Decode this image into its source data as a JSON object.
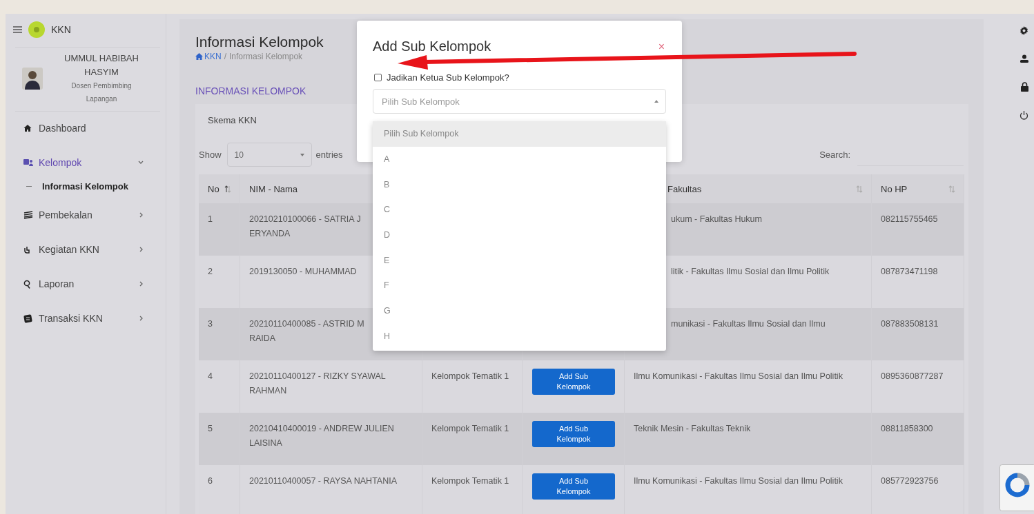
{
  "sidebar": {
    "brand": "KKN",
    "user": {
      "name": "UMMUL HABIBAH HASYIM",
      "role": "Dosen Pembimbing Lapangan"
    },
    "items": [
      {
        "label": "Dashboard",
        "active": false
      },
      {
        "label": "Kelompok",
        "active": true,
        "expanded": true,
        "children": [
          {
            "label": "Informasi Kelompok",
            "selected": true
          }
        ]
      },
      {
        "label": "Pembekalan",
        "active": false,
        "expanded": false
      },
      {
        "label": "Kegiatan KKN",
        "active": false,
        "expanded": false
      },
      {
        "label": "Laporan",
        "active": false,
        "expanded": false
      },
      {
        "label": "Transaksi KKN",
        "active": false,
        "expanded": false
      }
    ]
  },
  "page": {
    "title": "Informasi Kelompok",
    "breadcrumb": [
      "KKN",
      "Informasi Kelompok"
    ],
    "breadcrumb_separator": "/",
    "section_title": "INFORMASI KELOMPOK",
    "filter_label": "Skema KKN"
  },
  "table_controls": {
    "show_label": "Show",
    "page_size": "10",
    "entries_label": "entries",
    "search_label": "Search:"
  },
  "table": {
    "columns": [
      {
        "label": "No",
        "sorted": true
      },
      {
        "label": "NIM - Nama"
      },
      {
        "label": "Fakultas",
        "sorted": false
      },
      {
        "label": "No HP",
        "sorted": false
      }
    ],
    "rows": [
      {
        "no": "1",
        "nim_nama": "20210210100066 - SATRIA J\nERYANDA",
        "fakultas": "ukum - Fakultas Hukum",
        "no_hp": "082115755465"
      },
      {
        "no": "2",
        "nim_nama": "2019130050 - MUHAMMAD",
        "fakultas": "litik - Fakultas Ilmu Sosial dan Ilmu Politik",
        "no_hp": "087873471198"
      },
      {
        "no": "3",
        "nim_nama": "20210110400085 - ASTRID M\nRAIDA",
        "fakultas": "munikasi - Fakultas Ilmu Sosial dan Ilmu",
        "no_hp": "087883508131"
      },
      {
        "no": "4",
        "nim_nama": "20210110400127 - RIZKY SYAWAL RAHMAN",
        "kelompok": "Kelompok Tematik 1",
        "action": "Add Sub Kelompok",
        "fakultas": "Ilmu Komunikasi - Fakultas Ilmu Sosial dan Ilmu Politik",
        "no_hp": "0895360877287"
      },
      {
        "no": "5",
        "nim_nama": "20210410400019 - ANDREW JULIEN LAISINA",
        "kelompok": "Kelompok Tematik 1",
        "action": "Add Sub Kelompok",
        "fakultas": "Teknik Mesin - Fakultas Teknik",
        "no_hp": "08811858300"
      },
      {
        "no": "6",
        "nim_nama": "20210110400057 - RAYSA NAHTANIA",
        "kelompok": "Kelompok Tematik 1",
        "action": "Add Sub Kelompok",
        "fakultas": "Ilmu Komunikasi - Fakultas Ilmu Sosial dan Ilmu Politik",
        "no_hp": "085772923756"
      }
    ]
  },
  "modal": {
    "title": "Add Sub Kelompok",
    "close": "×",
    "checkbox": {
      "label": "Jadikan Ketua Sub Kelompok?",
      "checked": false
    },
    "select": {
      "placeholder": "Pilih Sub Kelompok",
      "expanded": true,
      "options": [
        {
          "label": "Pilih Sub Kelompok",
          "selected": true
        },
        {
          "label": "A",
          "selected": false
        },
        {
          "label": "B",
          "selected": false
        },
        {
          "label": "C",
          "selected": false
        },
        {
          "label": "D",
          "selected": false
        },
        {
          "label": "E",
          "selected": false
        },
        {
          "label": "F",
          "selected": false
        },
        {
          "label": "G",
          "selected": false
        },
        {
          "label": "H",
          "selected": false
        }
      ]
    }
  }
}
